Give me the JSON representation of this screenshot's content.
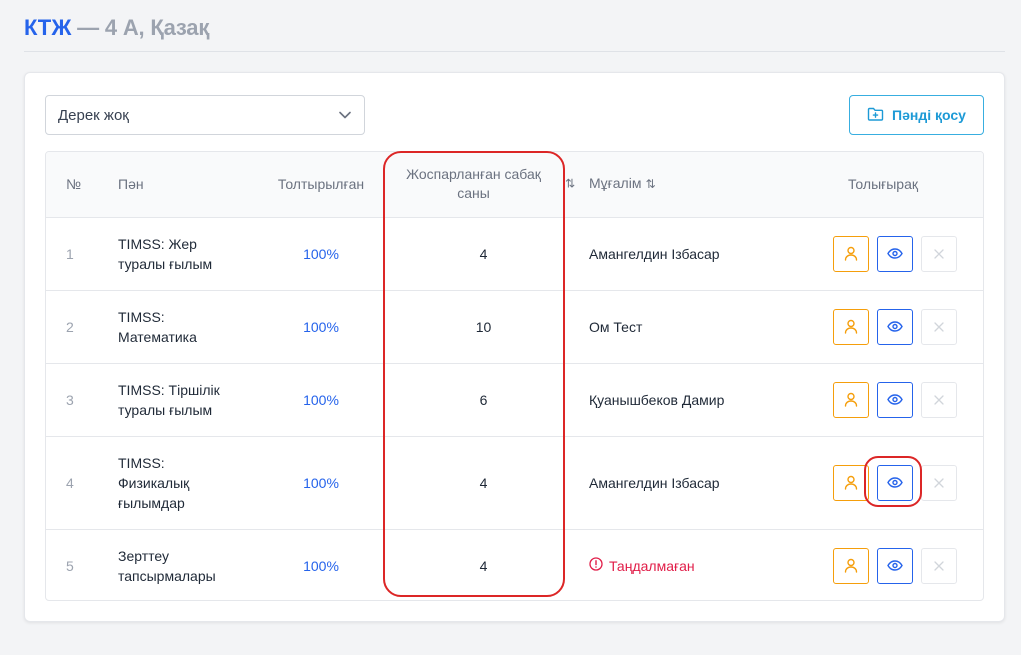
{
  "header": {
    "title_main": "КТЖ",
    "title_sep": " — ",
    "title_class": "4 А, Қазақ"
  },
  "filter": {
    "selected": "Дерек жоқ"
  },
  "toolbar": {
    "add_subject_label": "Пәнді қосу"
  },
  "table": {
    "columns": {
      "num": "№",
      "subject": "Пән",
      "filled": "Толтырылған",
      "planned": "Жоспарланған сабақ саны",
      "teacher": "Мұғалім",
      "details": "Толығырақ"
    },
    "rows": [
      {
        "num": "1",
        "subject_lines": [
          "TIMSS: Жер",
          "туралы ғылым"
        ],
        "filled": "100%",
        "planned": "4",
        "teacher": "Амангелдин Ізбасар",
        "assigned": true
      },
      {
        "num": "2",
        "subject_lines": [
          "TIMSS:",
          "Математика"
        ],
        "filled": "100%",
        "planned": "10",
        "teacher": "Ом Тест",
        "assigned": true
      },
      {
        "num": "3",
        "subject_lines": [
          "TIMSS: Тіршілік",
          "туралы ғылым"
        ],
        "filled": "100%",
        "planned": "6",
        "teacher": "Қуанышбеков Дамир",
        "assigned": true
      },
      {
        "num": "4",
        "subject_lines": [
          "TIMSS:",
          "Физикалық",
          "ғылымдар"
        ],
        "filled": "100%",
        "planned": "4",
        "teacher": "Амангелдин Ізбасар",
        "assigned": true
      },
      {
        "num": "5",
        "subject_lines": [
          "Зерттеу",
          "тапсырмалары"
        ],
        "filled": "100%",
        "planned": "4",
        "teacher": "Таңдалмаған",
        "assigned": false
      }
    ]
  },
  "colors": {
    "primary": "#2563eb",
    "accent_cyan": "#1d9ad6",
    "user_btn": "#f59e0b",
    "unassigned": "#e11d48",
    "highlight": "#dc2626"
  },
  "icons": {
    "select_chevron": "chevron-down-icon",
    "add_button": "folder-plus-icon",
    "sort": "sort-icon",
    "assign_teacher": "user-icon",
    "view": "eye-icon",
    "delete": "close-icon",
    "warning": "info-circle-icon"
  }
}
